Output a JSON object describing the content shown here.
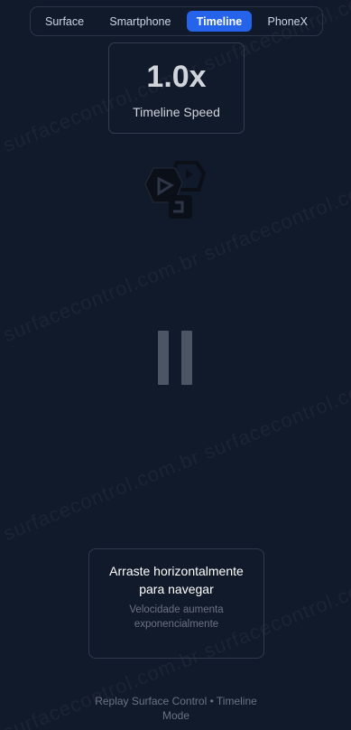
{
  "tabs": [
    {
      "label": "Surface",
      "active": false
    },
    {
      "label": "Smartphone",
      "active": false
    },
    {
      "label": "Timeline",
      "active": true
    },
    {
      "label": "PhoneX",
      "active": false
    }
  ],
  "speed": {
    "value": "1.0x",
    "label": "Timeline Speed"
  },
  "logo": {
    "icon": "replay-logo-icon"
  },
  "pause": {
    "icon": "pause-icon"
  },
  "hint": {
    "title": "Arraste horizontalmente para navegar",
    "subtitle": "Velocidade aumenta exponencialmente"
  },
  "footer": {
    "text": "Replay Surface Control • Timeline Mode"
  },
  "watermark": {
    "text": "surfacecontrol.com.br surfacecontrol.com.br"
  },
  "colors": {
    "accent": "#2563eb",
    "background": "#111a2b"
  }
}
